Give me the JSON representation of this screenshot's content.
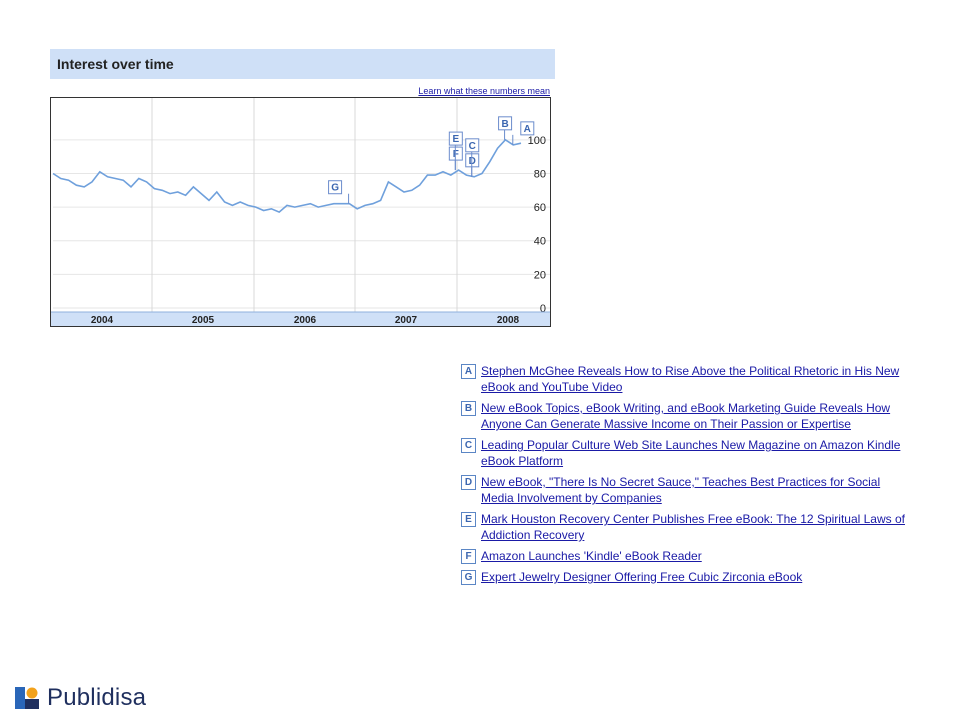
{
  "header": {
    "title": "Interest over time",
    "learn_link": "Learn what these numbers mean"
  },
  "chart_data": {
    "type": "line",
    "x": [
      "2003-10",
      "2003-11",
      "2003-12",
      "2004-01",
      "2004-02",
      "2004-03",
      "2004-04",
      "2004-05",
      "2004-06",
      "2004-07",
      "2004-08",
      "2004-09",
      "2004-10",
      "2004-11",
      "2004-12",
      "2005-01",
      "2005-02",
      "2005-03",
      "2005-04",
      "2005-05",
      "2005-06",
      "2005-07",
      "2005-08",
      "2005-09",
      "2005-10",
      "2005-11",
      "2005-12",
      "2006-01",
      "2006-02",
      "2006-03",
      "2006-04",
      "2006-05",
      "2006-06",
      "2006-07",
      "2006-08",
      "2006-09",
      "2006-10",
      "2006-11",
      "2006-12",
      "2007-01",
      "2007-02",
      "2007-03",
      "2007-04",
      "2007-05",
      "2007-06",
      "2007-07",
      "2007-08",
      "2007-09",
      "2007-10",
      "2007-11",
      "2007-12",
      "2008-01",
      "2008-02",
      "2008-03",
      "2008-04",
      "2008-05",
      "2008-06",
      "2008-07"
    ],
    "series": [
      {
        "values": [
          80,
          77,
          76,
          73,
          72,
          75,
          81,
          78,
          77,
          76,
          72,
          77,
          75,
          71,
          70,
          68,
          69,
          67,
          72,
          68,
          64,
          69,
          63,
          61,
          63,
          61,
          60,
          58,
          59,
          57,
          61,
          60,
          61,
          62,
          60,
          61,
          62,
          62,
          62,
          59,
          61,
          62,
          64,
          75,
          72,
          69,
          70,
          73,
          79,
          79,
          81,
          79,
          82,
          79,
          78,
          80,
          87,
          95,
          100,
          97,
          98
        ]
      }
    ],
    "x_ticks": [
      "2004",
      "2005",
      "2006",
      "2007",
      "2008"
    ],
    "y_ticks": [
      "0",
      "20",
      "40",
      "60",
      "80",
      "100"
    ],
    "ylim": [
      0,
      110
    ],
    "annotations": [
      {
        "letter": "G",
        "x": "2006-10"
      },
      {
        "letter": "F",
        "x": "2007-11"
      },
      {
        "letter": "E",
        "x": "2007-11"
      },
      {
        "letter": "D",
        "x": "2008-01"
      },
      {
        "letter": "C",
        "x": "2008-01"
      },
      {
        "letter": "B",
        "x": "2008-05"
      },
      {
        "letter": "A",
        "x": "2008-06"
      }
    ],
    "line_color": "#6fa0dc"
  },
  "news": [
    {
      "letter": "A",
      "text": "Stephen McGhee Reveals How to Rise Above the Political Rhetoric in His New eBook and YouTube Video"
    },
    {
      "letter": "B",
      "text": "New eBook Topics, eBook Writing, and eBook Marketing Guide Reveals How Anyone Can Generate Massive Income on Their Passion or Expertise"
    },
    {
      "letter": "C",
      "text": "Leading Popular Culture Web Site Launches New Magazine on Amazon Kindle eBook Platform"
    },
    {
      "letter": "D",
      "text": "New eBook, \"There Is No Secret Sauce,\" Teaches Best Practices for Social Media Involvement by Companies"
    },
    {
      "letter": "E",
      "text": "Mark Houston Recovery Center Publishes Free eBook: The 12 Spiritual Laws of Addiction Recovery"
    },
    {
      "letter": "F",
      "text": "Amazon Launches 'Kindle' eBook Reader"
    },
    {
      "letter": "G",
      "text": "Expert Jewelry Designer Offering Free Cubic Zirconia eBook"
    }
  ],
  "logo": {
    "text": "Publidisa"
  }
}
